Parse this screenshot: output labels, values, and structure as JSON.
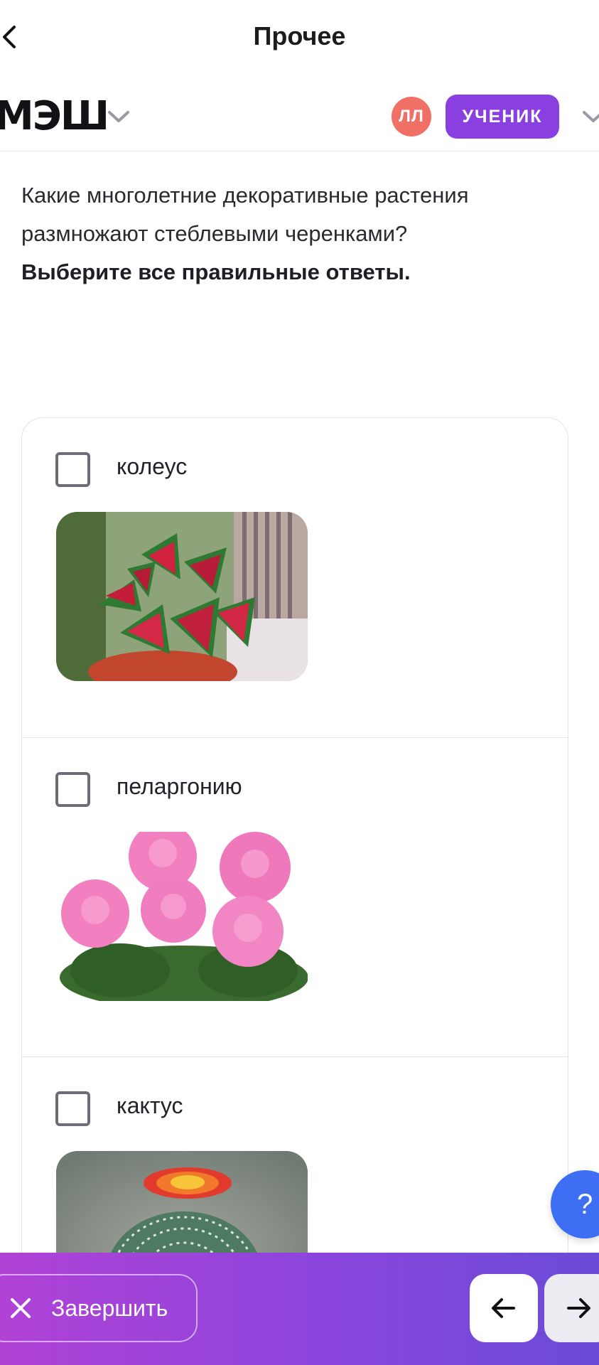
{
  "nav": {
    "title": "Прочее",
    "back_icon": "chevron-left-icon"
  },
  "header": {
    "logo": "МЭШ",
    "avatar_initials": "ЛЛ",
    "role": "УЧЕНИК",
    "accent": "#8a3fe0",
    "avatar_color": "#f07065"
  },
  "question": {
    "text": "Какие многолетние декоративные растения размножают стеблевыми черенками?",
    "instruction": "Выберите все правильные ответы."
  },
  "options": [
    {
      "label": "колеус",
      "checked": false,
      "image": "coleus-photo"
    },
    {
      "label": "пеларгонию",
      "checked": false,
      "image": "pelargonium-photo"
    },
    {
      "label": "кактус",
      "checked": false,
      "image": "cactus-photo"
    }
  ],
  "help": {
    "label": "?"
  },
  "bottom": {
    "finish_label": "Завершить",
    "prev_icon": "arrow-left-icon",
    "next_icon": "arrow-right-icon"
  }
}
